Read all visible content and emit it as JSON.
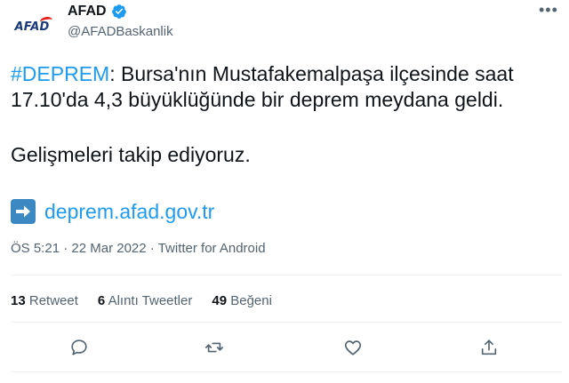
{
  "account": {
    "avatar_text": "AFAD",
    "display_name": "AFAD",
    "handle": "@AFADBaskanlik"
  },
  "more_label": "•••",
  "tweet": {
    "hashtag": "#DEPREM",
    "line1_rest": ": Bursa'nın Mustafakemalpaşa ilçesinde saat",
    "line2": "17.10'da 4,3 büyüklüğünde bir deprem meydana geldi.",
    "line3": "Gelişmeleri takip ediyoruz.",
    "link": "deprem.afad.gov.tr"
  },
  "meta": {
    "time": "ÖS 5:21",
    "date": "22 Mar 2022",
    "source": "Twitter for Android",
    "separator": " · "
  },
  "stats": {
    "retweet_count": "13",
    "retweet_label": "Retweet",
    "quote_count": "6",
    "quote_label": "Alıntı Tweetler",
    "like_count": "49",
    "like_label": "Beğeni"
  },
  "colors": {
    "accent": "#1d9bf0",
    "text": "#0f1419",
    "muted": "#536471",
    "divider": "#eff3f4"
  },
  "icons": [
    "verified-badge-icon",
    "more-icon",
    "arrow-right-icon",
    "reply-icon",
    "retweet-icon",
    "like-icon",
    "share-icon"
  ]
}
